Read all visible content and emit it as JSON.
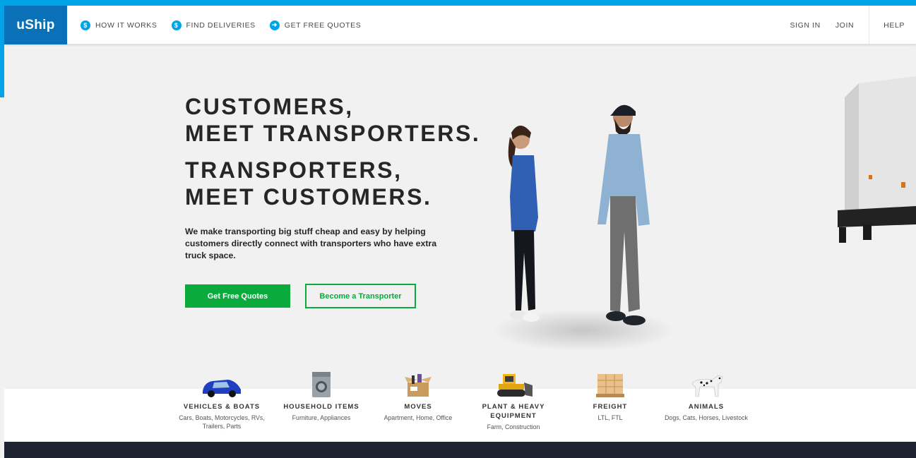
{
  "header": {
    "logo": "uShip",
    "nav": [
      {
        "label": "HOW IT WORKS",
        "icon": "dollar-badge-icon",
        "glyph": "$"
      },
      {
        "label": "FIND DELIVERIES",
        "icon": "location-pin-icon",
        "glyph": "$"
      },
      {
        "label": "GET FREE QUOTES",
        "icon": "arrow-right-circle-icon",
        "glyph": "➜"
      }
    ],
    "sign_in": "SIGN IN",
    "join": "JOIN",
    "help": "HELP"
  },
  "hero": {
    "line1": "CUSTOMERS,",
    "line2": "MEET TRANSPORTERS.",
    "line3": "TRANSPORTERS,",
    "line4": "MEET CUSTOMERS.",
    "description": "We make transporting big stuff cheap and easy by helping customers directly connect with transporters who have extra truck space.",
    "primary_button": "Get Free Quotes",
    "secondary_button": "Become a Transporter"
  },
  "categories": [
    {
      "title": "VEHICLES & BOATS",
      "sub": "Cars, Boats, Motorcycles, RVs, Trailers, Parts",
      "icon": "car-icon"
    },
    {
      "title": "HOUSEHOLD ITEMS",
      "sub": "Furniture, Appliances",
      "icon": "washing-machine-icon"
    },
    {
      "title": "MOVES",
      "sub": "Apartment, Home, Office",
      "icon": "moving-box-icon"
    },
    {
      "title": "PLANT & HEAVY EQUIPMENT",
      "sub": "Farm, Construction",
      "icon": "bulldozer-icon"
    },
    {
      "title": "FREIGHT",
      "sub": "LTL, FTL",
      "icon": "pallet-icon"
    },
    {
      "title": "ANIMALS",
      "sub": "Dogs, Cats, Horses, Livestock",
      "icon": "dalmatian-icon"
    }
  ],
  "colors": {
    "brand_blue": "#00a3e8",
    "logo_blue": "#0a71b8",
    "cta_green": "#0aab3c",
    "footer_dark": "#1d2330"
  }
}
